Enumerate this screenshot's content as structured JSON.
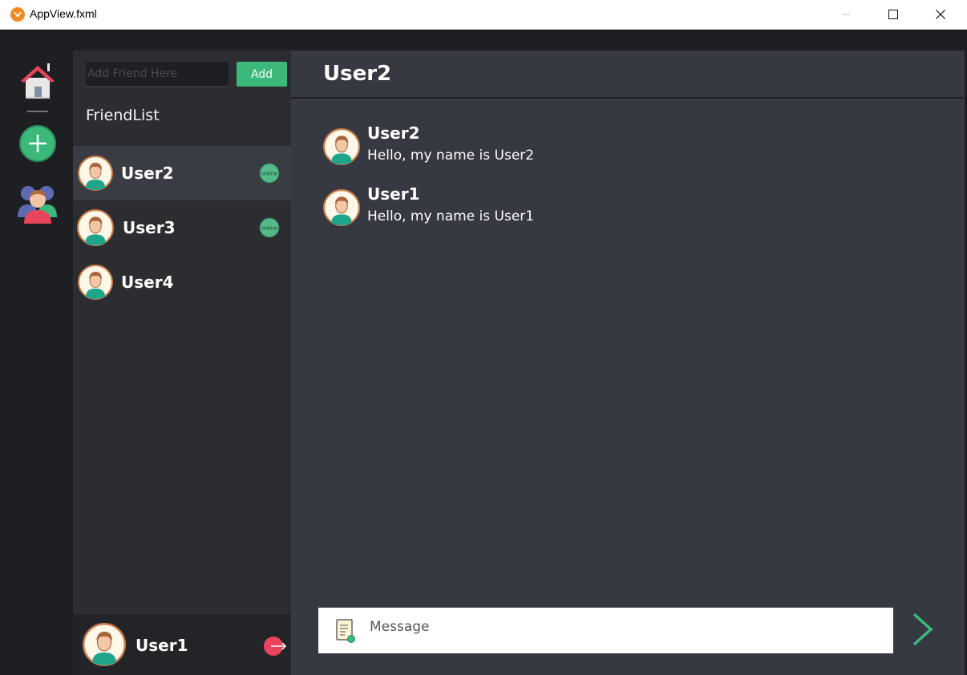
{
  "window": {
    "title": "AppView.fxml"
  },
  "sidebar": {
    "icons": [
      "home-icon",
      "add-server-icon",
      "friends-icon"
    ]
  },
  "friends_panel": {
    "add_placeholder": "Add Friend Here",
    "add_label": "Add",
    "title": "FriendList",
    "friends": [
      {
        "name": "User2",
        "status": "online",
        "selected": true
      },
      {
        "name": "User3",
        "status": "online",
        "selected": false
      },
      {
        "name": "User4",
        "status": "offline",
        "selected": false
      }
    ],
    "current_user": {
      "name": "User1"
    }
  },
  "chat": {
    "title": "User2",
    "messages": [
      {
        "author": "User2",
        "text": "Hello, my name is User2"
      },
      {
        "author": "User1",
        "text": "Hello, my name is User1"
      }
    ],
    "composer_placeholder": "Message"
  },
  "colors": {
    "accent": "#3bb87a",
    "online": "#55b98a",
    "logout": "#e8455d",
    "chat_bg": "#363842",
    "panel_bg": "#2b2d31",
    "rail_bg": "#1e1f22"
  }
}
